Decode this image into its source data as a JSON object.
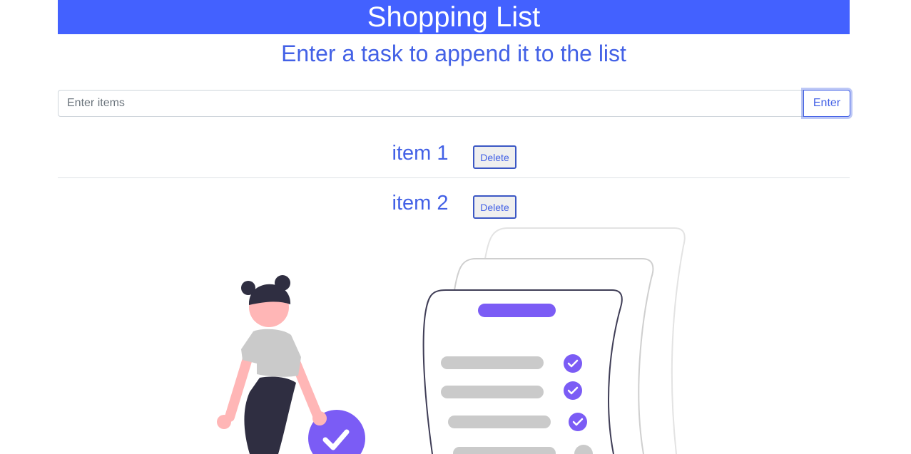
{
  "header": {
    "title": "Shopping List"
  },
  "subtitle": "Enter a task to append it to the list",
  "input": {
    "placeholder": "Enter items",
    "value": ""
  },
  "enter_button": {
    "label": "Enter"
  },
  "items": [
    {
      "label": "item 1",
      "delete_label": "Delete"
    },
    {
      "label": "item 2",
      "delete_label": "Delete"
    }
  ],
  "colors": {
    "header_bg": "#4361ff",
    "accent": "#4361e6",
    "illustration_purple": "#7b5cf5",
    "illustration_dark": "#2f2e41",
    "illustration_skin": "#ffb6b6",
    "illustration_gray": "#cacaca"
  },
  "illustration": {
    "name": "woman-with-checklist-illustration"
  }
}
